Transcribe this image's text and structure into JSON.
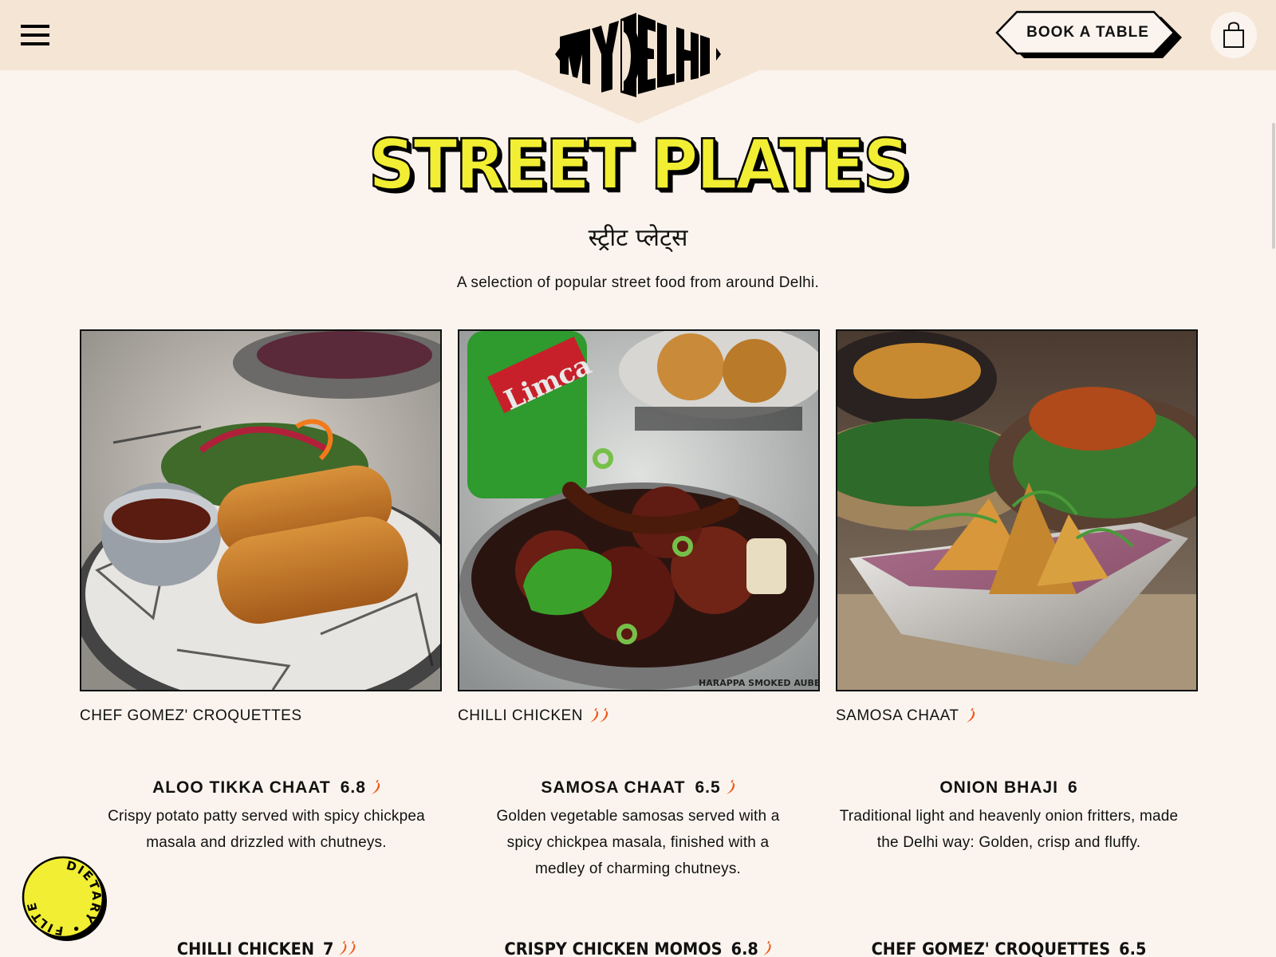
{
  "header": {
    "logo_text": "MYDELHI",
    "book_label": "BOOK A TABLE",
    "menu_icon": "hamburger-icon",
    "cart_icon": "shopping-bag-icon"
  },
  "colors": {
    "header_bg": "#f5e5d5",
    "page_bg": "#fbf4ee",
    "title_yellow": "#f1ee33",
    "chili_orange": "#f05a1a"
  },
  "section": {
    "title": "STREET PLATES",
    "title_hindi": "स्ट्रीट प्लेट्स",
    "intro": "A selection of popular street food from around Delhi."
  },
  "featured": [
    {
      "caption": "CHEF GOMEZ' CROQUETTES",
      "spice_level": 0
    },
    {
      "caption": "CHILLI CHICKEN",
      "spice_level": 2
    },
    {
      "caption": "SAMOSA CHAAT",
      "spice_level": 1
    }
  ],
  "menu_items": [
    {
      "name": "ALOO TIKKA CHAAT",
      "price": "6.8",
      "spice_level": 1,
      "description": "Crispy potato patty served with spicy chickpea masala and drizzled with chutneys."
    },
    {
      "name": "SAMOSA CHAAT",
      "price": "6.5",
      "spice_level": 1,
      "description": "Golden vegetable samosas served with a spicy chickpea masala, finished with a medley of charming chutneys."
    },
    {
      "name": "ONION BHAJI",
      "price": "6",
      "spice_level": 0,
      "description": "Traditional light and heavenly onion fritters, made the Delhi way: Golden, crisp and fluffy."
    },
    {
      "name": "CHILLI CHICKEN",
      "price": "7",
      "spice_level": 2,
      "description": ""
    },
    {
      "name": "CRISPY CHICKEN MOMOS",
      "price": "6.8",
      "spice_level": 1,
      "description": ""
    },
    {
      "name": "CHEF GOMEZ' CROQUETTES",
      "price": "6.5",
      "spice_level": 0,
      "description": ""
    }
  ],
  "dietary_badge": {
    "word1": "DIETARY",
    "word2": "FILTERS"
  }
}
